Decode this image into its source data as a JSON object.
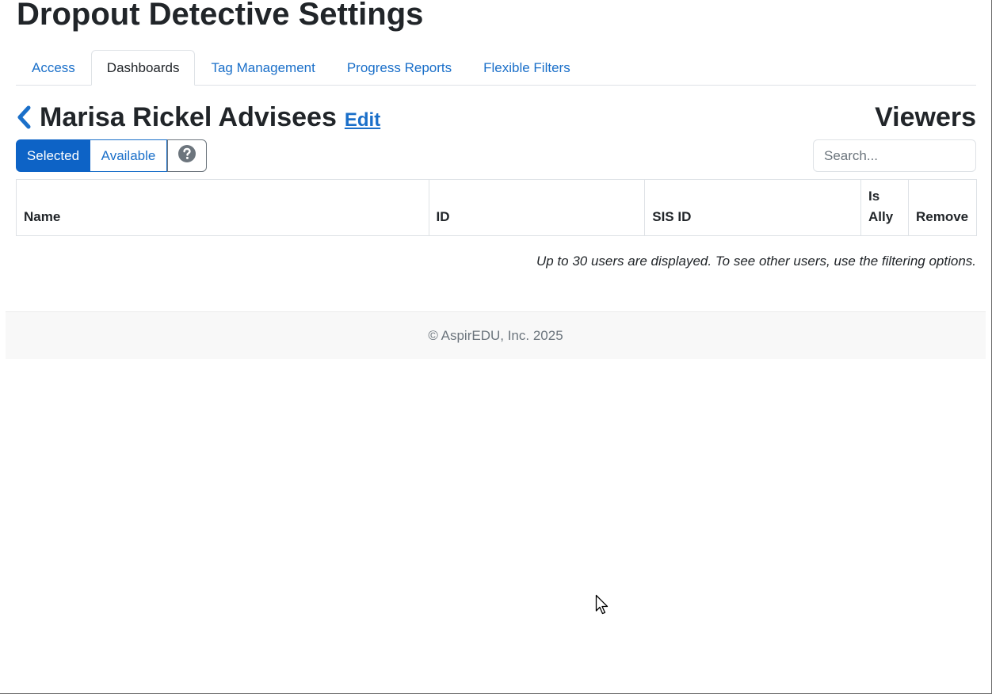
{
  "page": {
    "title": "Dropout Detective Settings"
  },
  "tabs": [
    {
      "label": "Access",
      "active": false
    },
    {
      "label": "Dashboards",
      "active": true
    },
    {
      "label": "Tag Management",
      "active": false
    },
    {
      "label": "Progress Reports",
      "active": false
    },
    {
      "label": "Flexible Filters",
      "active": false
    }
  ],
  "dashboard": {
    "back_icon": "chevron-left-icon",
    "name": "Marisa Rickel Advisees",
    "edit_label": "Edit"
  },
  "viewers": {
    "title": "Viewers",
    "toggle": {
      "selected_label": "Selected",
      "available_label": "Available",
      "help_icon": "question-circle-icon",
      "active": "Selected"
    },
    "search": {
      "placeholder": "Search...",
      "value": ""
    },
    "table": {
      "columns": [
        "Name",
        "ID",
        "SIS ID",
        "Is Ally",
        "Remove"
      ],
      "rows": []
    },
    "note": "Up to 30 users are displayed. To see other users, use the filtering options."
  },
  "footer": {
    "text": "© AspirEDU, Inc. 2025"
  },
  "colors": {
    "primary": "#0d63c6",
    "link": "#1a6fc9",
    "text": "#212529",
    "muted": "#6c757d",
    "footer_bg": "#f8f8f8"
  }
}
